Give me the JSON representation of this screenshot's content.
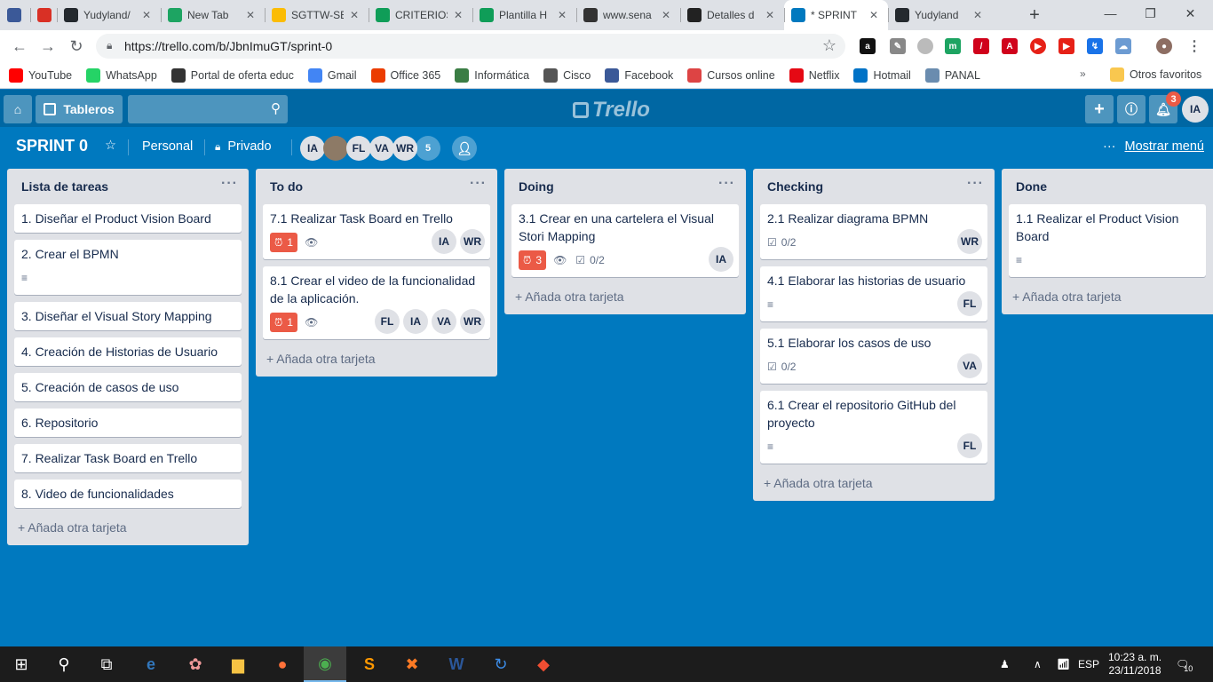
{
  "browser": {
    "tabs": [
      {
        "title": "",
        "icon": "shield-icon",
        "color": "#3b5998"
      },
      {
        "title": "",
        "icon": "gmail-icon",
        "color": "#d93025"
      },
      {
        "title": "Yudyland/",
        "icon": "github-icon",
        "color": "#24292e"
      },
      {
        "title": "New Tab",
        "icon": "my-icon",
        "color": "#1da462"
      },
      {
        "title": "SGTTW-SE",
        "icon": "drive-icon",
        "color": "#fbbc04"
      },
      {
        "title": "CRITERIOS",
        "icon": "sheets-icon",
        "color": "#0f9d58"
      },
      {
        "title": "Plantilla H",
        "icon": "sheets-icon",
        "color": "#0f9d58"
      },
      {
        "title": "www.sena",
        "icon": "sena-icon",
        "color": "#333333"
      },
      {
        "title": "Detalles d",
        "icon": "blackboard-icon",
        "color": "#222222"
      },
      {
        "title": "* SPRINT",
        "icon": "trello-icon",
        "color": "#0079bf"
      },
      {
        "title": "Yudyland",
        "icon": "github-icon",
        "color": "#24292e"
      }
    ],
    "active_tab": 9,
    "url": "https://trello.com/b/JbnImuGT/sprint-0",
    "bookmarks": [
      {
        "label": "YouTube",
        "icon": "youtube-icon",
        "color": "#ff0000"
      },
      {
        "label": "WhatsApp",
        "icon": "whatsapp-icon",
        "color": "#25d366"
      },
      {
        "label": "Portal de oferta educ",
        "icon": "sena-icon",
        "color": "#333333"
      },
      {
        "label": "Gmail",
        "icon": "google-icon",
        "color": "#4285f4"
      },
      {
        "label": "Office 365",
        "icon": "office-icon",
        "color": "#eb3c00"
      },
      {
        "label": "Informática",
        "icon": "informatica-icon",
        "color": "#3a7d44"
      },
      {
        "label": "Cisco",
        "icon": "cisco-icon",
        "color": "#555555"
      },
      {
        "label": "Facebook",
        "icon": "facebook-icon",
        "color": "#3b5998"
      },
      {
        "label": "Cursos online",
        "icon": "courses-icon",
        "color": "#d44"
      },
      {
        "label": "Netflix",
        "icon": "netflix-icon",
        "color": "#e50914"
      },
      {
        "label": "Hotmail",
        "icon": "outlook-icon",
        "color": "#0072c6"
      },
      {
        "label": "PANAL",
        "icon": "panal-icon",
        "color": "#6a8caf"
      }
    ],
    "other_bookmarks": "Otros favoritos"
  },
  "trello": {
    "boards_label": "Tableros",
    "logo_text": "Trello",
    "notifications_count": "3",
    "user_initials": "IA",
    "board_title": "SPRINT 0",
    "team": "Personal",
    "visibility": "Privado",
    "members": [
      "IA",
      "",
      "FL",
      "VA",
      "WR"
    ],
    "extra_members": "5",
    "show_menu": "Mostrar menú",
    "add_card_label": "Añada otra tarjeta"
  },
  "lists": [
    {
      "title": "Lista de tareas",
      "cards": [
        {
          "text": "1. Diseñar el Product Vision Board"
        },
        {
          "text": "2. Crear el BPMN",
          "description": true
        },
        {
          "text": "3. Diseñar el Visual Story Mapping"
        },
        {
          "text": "4. Creación de Historias de Usuario"
        },
        {
          "text": "5. Creación de casos de uso"
        },
        {
          "text": "6. Repositorio"
        },
        {
          "text": "7. Realizar Task Board en Trello"
        },
        {
          "text": "8. Video de funcionalidades"
        }
      ]
    },
    {
      "title": "To do",
      "cards": [
        {
          "text": "7.1 Realizar Task Board en Trello",
          "due": "1",
          "watch": true,
          "members": [
            "IA",
            "WR"
          ]
        },
        {
          "text": "8.1 Crear el video de la funcionalidad de la aplicación.",
          "due": "1",
          "watch": true,
          "members": [
            "FL",
            "IA",
            "VA",
            "WR"
          ]
        }
      ]
    },
    {
      "title": "Doing",
      "cards": [
        {
          "text": "3.1 Crear en una cartelera el Visual Stori Mapping",
          "due": "3",
          "watch": true,
          "checklist": "0/2",
          "members": [
            "IA"
          ]
        }
      ]
    },
    {
      "title": "Checking",
      "cards": [
        {
          "text": "2.1 Realizar diagrama BPMN",
          "checklist": "0/2",
          "members": [
            "WR"
          ]
        },
        {
          "text": "4.1 Elaborar las historias de usuario",
          "description": true,
          "members": [
            "FL"
          ]
        },
        {
          "text": "5.1 Elaborar los casos de uso",
          "checklist": "0/2",
          "members": [
            "VA"
          ]
        },
        {
          "text": "6.1 Crear el repositorio GitHub del proyecto",
          "description": true,
          "members": [
            "FL"
          ]
        }
      ]
    },
    {
      "title": "Done",
      "cards": [
        {
          "text": "1.1 Realizar el Product Vision Board",
          "description": true
        }
      ]
    }
  ],
  "taskbar": {
    "language": "ESP",
    "time": "10:23 a. m.",
    "date": "23/11/2018",
    "notification_count": "10"
  }
}
